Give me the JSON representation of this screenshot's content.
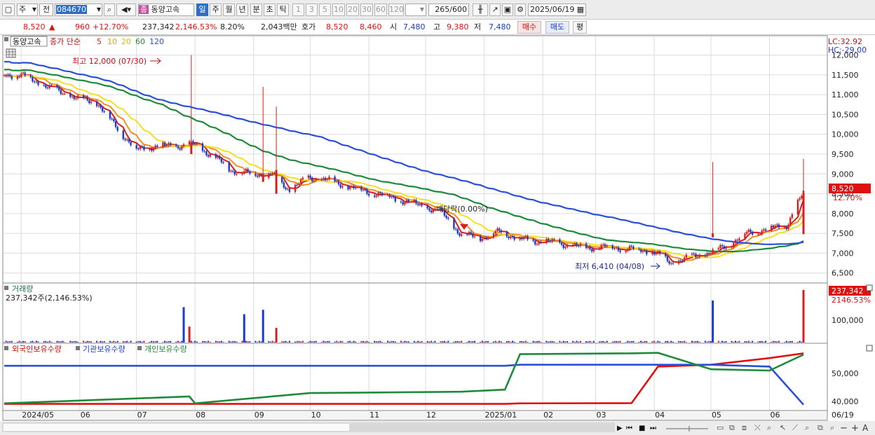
{
  "toolbar": {
    "period_mode": "주",
    "prev_label": "전",
    "stock_code": "084670",
    "stock_name": "동양고속",
    "stock_name_badge": "종",
    "periods": [
      "일",
      "주",
      "월",
      "년",
      "분",
      "초",
      "틱"
    ],
    "active_period": "일",
    "intervals": [
      "1",
      "3",
      "5",
      "10",
      "20",
      "30",
      "60",
      "120"
    ],
    "count": "265",
    "count_total": "/600",
    "date": "2025/06/19"
  },
  "quote": {
    "price": "8,520",
    "change": "960",
    "change_pct": "+12.70%",
    "volume": "237,342",
    "volume_ratio": "2,146.53%",
    "turnover": "8.20%",
    "amount": "2,043백만",
    "bid_label": "호가",
    "ask_price": "8,520",
    "bid_price": "8,460",
    "open_label": "시",
    "open": "7,480",
    "high_label": "고",
    "high": "9,380",
    "low_label": "저",
    "low": "7,480",
    "buy_label": "매수",
    "sell_label": "매도",
    "eval_label": "평"
  },
  "price_panel": {
    "name_tag": "동양고속",
    "ma_title": "종가 단순",
    "ma_periods": [
      "5",
      "10",
      "20",
      "60",
      "120"
    ],
    "ma_colors": [
      "#d42020",
      "#f09020",
      "#f4e020",
      "#1e8a3a",
      "#2a4ed8"
    ],
    "high_marker": "최고 12,000 (07/30)",
    "low_marker": "최저 6,410 (04/08)",
    "dividend_marker": "배당락(0.00%)",
    "lc": "LC:32.92",
    "hc": "HC:-29.00",
    "price_badge": "8,520",
    "pct_badge": "12.70%"
  },
  "volume_panel": {
    "title": "거래량",
    "subtitle": "237,342주(2,146.53%)",
    "badge1": "237,342",
    "badge2": "2146.53%",
    "tick": "100,000"
  },
  "holding_panel": {
    "legend": [
      "외국인보유수량",
      "기관보유수량",
      "개인보유수량"
    ],
    "ticks": [
      "50,000",
      "40,000"
    ]
  },
  "x_labels": [
    "2024/05",
    "06",
    "07",
    "08",
    "09",
    "10",
    "11",
    "12",
    "2025/01",
    "02",
    "03",
    "04",
    "05",
    "06",
    "06/19"
  ],
  "chart_data": [
    {
      "type": "line",
      "title": "동양고속 일봉",
      "x": [
        "2024-05-01",
        "2024-05-10",
        "2024-05-20",
        "2024-05-31",
        "2024-06-10",
        "2024-06-20",
        "2024-07-01",
        "2024-07-10",
        "2024-07-20",
        "2024-07-31",
        "2024-08-09",
        "2024-08-20",
        "2024-08-30",
        "2024-09-10",
        "2024-09-20",
        "2024-09-30",
        "2024-10-10",
        "2024-10-20",
        "2024-10-31",
        "2024-11-10",
        "2024-11-20",
        "2024-11-29",
        "2024-12-10",
        "2024-12-20",
        "2024-12-31",
        "2025-01-10",
        "2025-01-20",
        "2025-01-31",
        "2025-02-10",
        "2025-02-20",
        "2025-02-28",
        "2025-03-10",
        "2025-03-20",
        "2025-03-31",
        "2025-04-10",
        "2025-04-20",
        "2025-04-30",
        "2025-05-10",
        "2025-05-20",
        "2025-05-30",
        "2025-06-10",
        "2025-06-19"
      ],
      "series": [
        {
          "name": "종가",
          "values": [
            11500,
            11300,
            11100,
            10900,
            10800,
            10200,
            9600,
            9700,
            9700,
            9750,
            9500,
            9100,
            9000,
            9000,
            8600,
            8900,
            8850,
            8700,
            8550,
            8450,
            8300,
            8200,
            8000,
            7450,
            7400,
            7550,
            7350,
            7300,
            7250,
            7150,
            7150,
            7150,
            7100,
            7050,
            6750,
            6900,
            7000,
            7200,
            7500,
            7600,
            7700,
            8520
          ]
        }
      ],
      "ylim": [
        6300,
        12400
      ]
    },
    {
      "type": "bar",
      "title": "거래량",
      "categories": [
        "2024-07-26",
        "2024-07-29",
        "2024-08-27",
        "2024-09-06",
        "2024-09-13",
        "2025-05-02",
        "2025-06-19"
      ],
      "series": [
        {
          "name": "거래량",
          "values": [
            160000,
            72000,
            128000,
            148000,
            66000,
            190000,
            237342
          ]
        }
      ],
      "ylim": [
        0,
        250000
      ]
    },
    {
      "type": "line",
      "title": "보유수량",
      "x": [
        "2024-05",
        "2024-07",
        "2024-08",
        "2024-10",
        "2024-12",
        "2025-01",
        "2025-02",
        "2025-03",
        "2025-04",
        "2025-05",
        "2025-06",
        "2025-06-19"
      ],
      "series": [
        {
          "name": "외국인보유수량",
          "values": [
            38400,
            38400,
            38400,
            38400,
            38400,
            38400,
            38600,
            38700,
            52500,
            53200,
            55700,
            57500
          ]
        },
        {
          "name": "기관보유수량",
          "values": [
            52800,
            52800,
            52800,
            52800,
            52800,
            52800,
            53200,
            53200,
            53200,
            53200,
            52500,
            38100
          ]
        },
        {
          "name": "개인보유수량",
          "values": [
            38600,
            41200,
            38600,
            42500,
            43000,
            43800,
            57200,
            57500,
            57700,
            51500,
            51000,
            57000
          ]
        }
      ],
      "ylim": [
        37500,
        60000
      ]
    }
  ]
}
